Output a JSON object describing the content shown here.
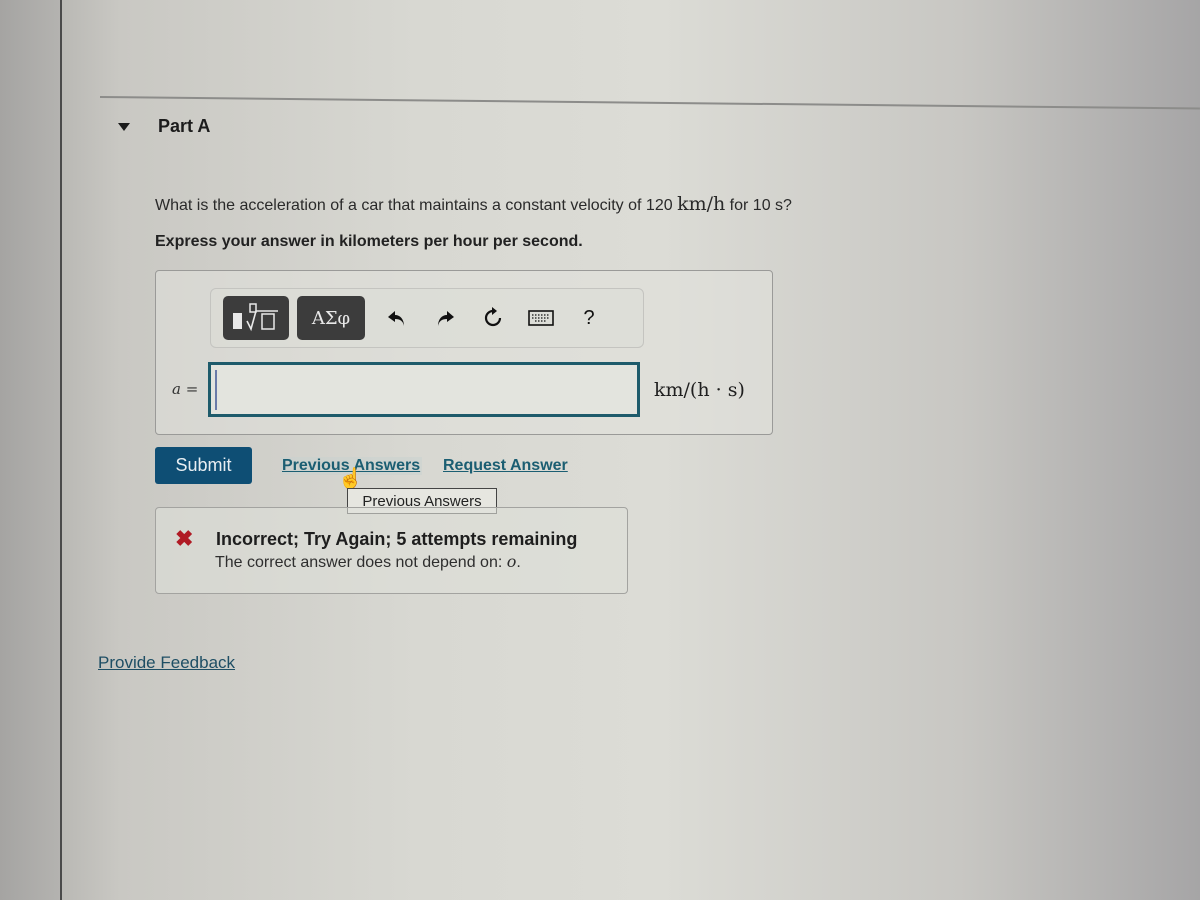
{
  "part": {
    "title": "Part A",
    "expanded": true
  },
  "question": {
    "text_before": "What is the acceleration of a car that maintains a constant velocity of 120 ",
    "velocity_unit": "km/h",
    "text_after": " for 10 s?",
    "instruction": "Express your answer in kilometers per hour per second."
  },
  "toolbar": {
    "templates_label": "templates",
    "greek_label": "ΑΣφ",
    "undo_icon": "undo-icon",
    "redo_icon": "redo-icon",
    "reset_icon": "reset-icon",
    "keyboard_icon": "keyboard-icon",
    "help_label": "?"
  },
  "answer": {
    "variable_label": "a =",
    "value": "",
    "unit": "km/(h · s)"
  },
  "actions": {
    "submit_label": "Submit",
    "previous_answers_label": "Previous Answers",
    "request_answer_label": "Request Answer",
    "tooltip": "Previous Answers"
  },
  "feedback": {
    "status": "incorrect",
    "status_color": "#b01a24",
    "title": "Incorrect; Try Again; 5 attempts remaining",
    "detail_prefix": "The correct answer does not depend on: ",
    "detail_variable": "o",
    "detail_suffix": "."
  },
  "footer": {
    "provide_feedback_label": "Provide Feedback"
  }
}
